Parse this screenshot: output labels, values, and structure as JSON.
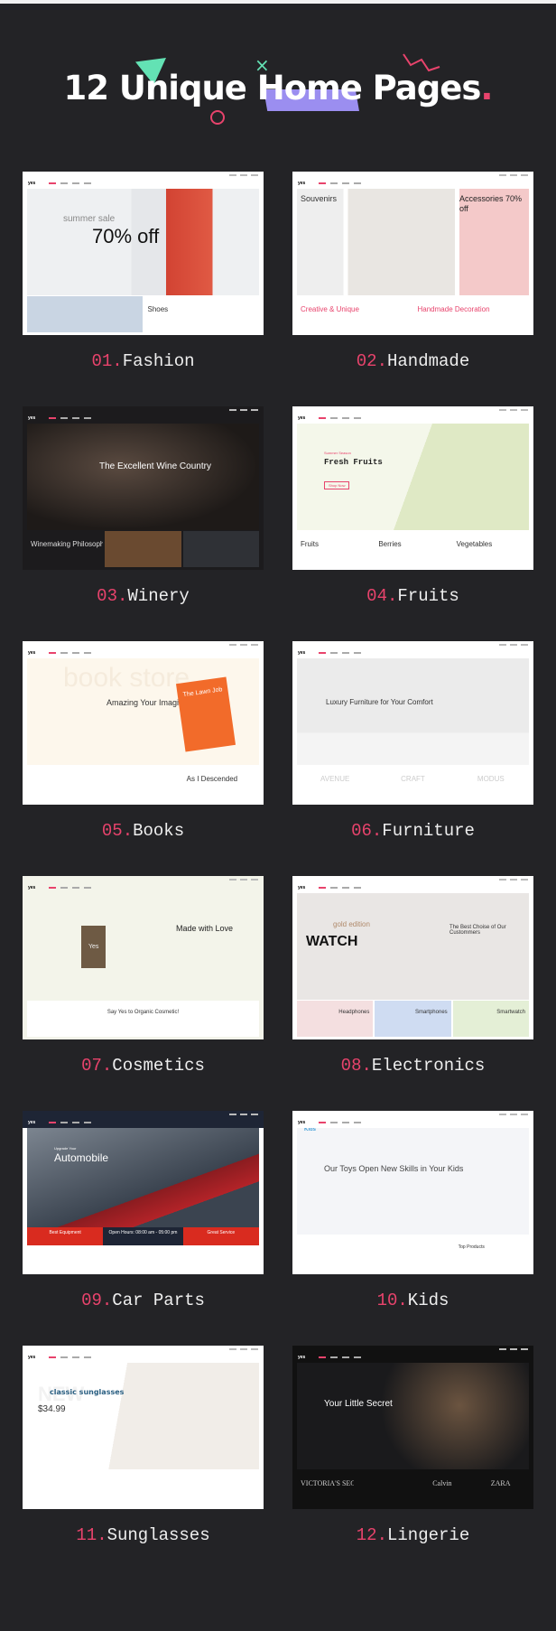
{
  "header": {
    "title": "12 Unique Home Pages",
    "title_dot": ".",
    "accent": "#e8436c",
    "decor_colors": [
      "#63e2b4",
      "#9b8ef0",
      "#e8436c"
    ]
  },
  "logo_text": "yes",
  "pages": [
    {
      "num": "01",
      "name": "Fashion",
      "kicker": "summer sale",
      "headline": "70% off",
      "button": "",
      "strip": [
        "",
        "Shoes"
      ]
    },
    {
      "num": "02",
      "name": "Handmade",
      "kicker": "Souvenirs",
      "headline": "Accessories 70% off",
      "button": "",
      "strip": [
        "Creative & Unique",
        "Handmade Decoration"
      ]
    },
    {
      "num": "03",
      "name": "Winery",
      "kicker": "",
      "headline": "The Excellent Wine Country",
      "button": "",
      "strip": [
        "Winemaking Philosophy",
        "",
        ""
      ]
    },
    {
      "num": "04",
      "name": "Fruits",
      "kicker": "Summer Season",
      "headline": "Fresh Fruits",
      "button": "Shop Now",
      "strip": [
        "Fruits",
        "Berries",
        "Vegetables"
      ]
    },
    {
      "num": "05",
      "name": "Books",
      "kicker": "book store",
      "headline": "Amazing Your Imagination",
      "button": "The Lawn Job",
      "strip": [
        "",
        "",
        "As I Descended"
      ]
    },
    {
      "num": "06",
      "name": "Furniture",
      "kicker": "",
      "headline": "Luxury Furniture for Your Comfort",
      "button": "",
      "strip": [
        "AVENUE",
        "CRAFT",
        "MODUS"
      ]
    },
    {
      "num": "07",
      "name": "Cosmetics",
      "kicker": "Yes",
      "headline": "Made with Love",
      "button": "",
      "strip": [
        "Say Yes to Organic Cosmetic!"
      ]
    },
    {
      "num": "08",
      "name": "Electronics",
      "kicker": "gold edition",
      "headline": "WATCH",
      "button": "The Best Choise of Our Custommers",
      "strip": [
        "Headphones",
        "Smartphones",
        "Smartwatch"
      ]
    },
    {
      "num": "09",
      "name": "Car Parts",
      "kicker": "Upgrade Your",
      "headline": "Automobile",
      "button": "",
      "strip": [
        "Best Equipment",
        "Open Hours: 08:00 am - 05:00 pm",
        "Great Service"
      ]
    },
    {
      "num": "10",
      "name": "Kids",
      "kicker": "Kids",
      "headline": "Our Toys Open New Skills in Your Kids",
      "button": "",
      "strip": [
        "",
        "Top Products"
      ]
    },
    {
      "num": "11",
      "name": "Sunglasses",
      "kicker": "NEW",
      "headline": "classic sunglasses",
      "button": "$34.99",
      "strip": [
        ""
      ]
    },
    {
      "num": "12",
      "name": "Lingerie",
      "kicker": "",
      "headline": "Your Little Secret",
      "button": "",
      "strip": [
        "VICTORIA'S SECRET",
        "",
        "Calvin",
        "ZARA"
      ]
    }
  ]
}
